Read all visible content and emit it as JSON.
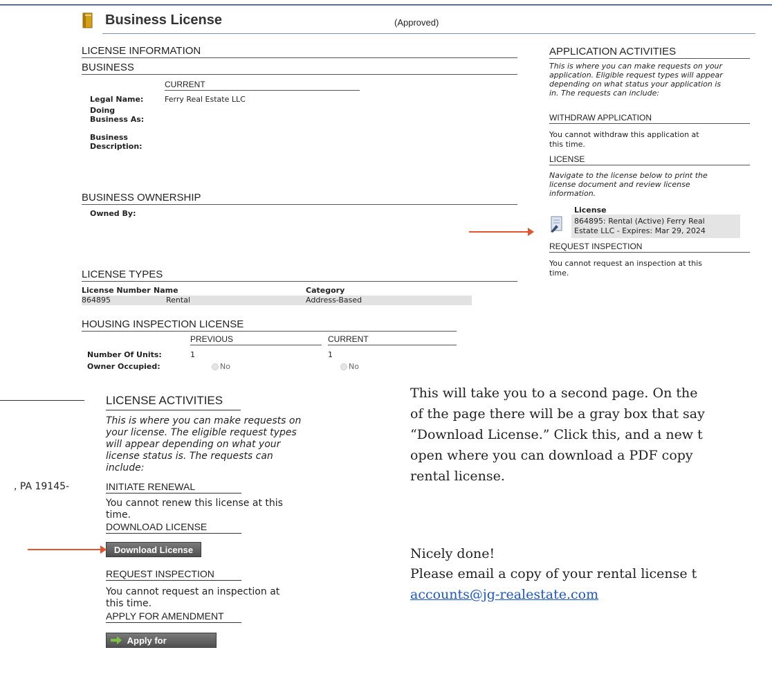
{
  "header": {
    "title": "Business License",
    "status": "(Approved)"
  },
  "license_info": {
    "section_title": "LICENSE INFORMATION",
    "business": {
      "title": "BUSINESS",
      "col_current": "CURRENT",
      "legal_name_label": "Legal Name:",
      "legal_name_value": "Ferry Real Estate LLC",
      "dba_label_1": "Doing",
      "dba_label_2": "Business As:",
      "desc_label_1": "Business",
      "desc_label_2": "Description:"
    },
    "ownership": {
      "title": "BUSINESS OWNERSHIP",
      "owned_by_label": "Owned By:"
    },
    "license_types": {
      "title": "LICENSE TYPES",
      "col_number": "License Number",
      "col_name": "Name",
      "col_category": "Category",
      "rows": [
        {
          "number": "864895",
          "name": "Rental",
          "category": "Address-Based"
        }
      ]
    },
    "housing": {
      "title": "HOUSING INSPECTION LICENSE",
      "col_previous": "PREVIOUS",
      "col_current": "CURRENT",
      "units_label": "Number Of Units:",
      "units_previous": "1",
      "units_current": "1",
      "owner_label": "Owner Occupied:",
      "owner_previous": "No",
      "owner_current": "No"
    }
  },
  "application_activities": {
    "title": "APPLICATION ACTIVITIES",
    "intro_1": "This is where you can make requests on your",
    "intro_2": "application. Eligible request types will appear",
    "intro_3": "depending on what status your application is",
    "intro_4": "in. The requests can include:",
    "withdraw_title": "WITHDRAW APPLICATION",
    "withdraw_text_1": "You cannot withdraw this application at",
    "withdraw_text_2": "this time.",
    "license_title": "LICENSE",
    "license_text_1": "Navigate to the license below to print the",
    "license_text_2": "license document and review license",
    "license_text_3": "information.",
    "license_link_label": "License",
    "license_link_text_1": "864895: Rental (Active) Ferry Real",
    "license_link_text_2": "Estate LLC - Expires: Mar 29, 2024",
    "inspection_title": "REQUEST INSPECTION",
    "inspection_text_1": "You cannot request an inspection at this",
    "inspection_text_2": "time."
  },
  "license_activities": {
    "address_fragment": ", PA 19145-",
    "title": "LICENSE ACTIVITIES",
    "intro_1": "This is where you can make requests on",
    "intro_2": "your license. The eligible request types",
    "intro_3": "will appear depending on what your",
    "intro_4": "license status is. The requests can",
    "intro_5": "include:",
    "renewal_title": "INITIATE RENEWAL",
    "renewal_text_1": "You cannot renew this license at this",
    "renewal_text_2": "time.",
    "download_title": "DOWNLOAD LICENSE",
    "download_button": "Download License",
    "inspection_title": "REQUEST INSPECTION",
    "inspection_text_1": "You cannot request an inspection at",
    "inspection_text_2": "this time.",
    "amend_title": "APPLY FOR AMENDMENT",
    "amend_button": "Apply for Amendment"
  },
  "instructions": {
    "line_1": "This will take you to a second page. On the",
    "line_2": "of the page there will be a gray box that say",
    "line_3": "“Download License.” Click this, and a new t",
    "line_4": "open where you can download a PDF copy",
    "line_5": "rental license.",
    "done": "Nicely done!",
    "email_line": "Please email a copy of your rental license t",
    "email": "accounts@jg-realestate.com"
  },
  "colors": {
    "arrow": "#e5532e",
    "link": "#1a56c8",
    "row_bg": "#e2e2e2",
    "button_bg": "#5e5e5e"
  }
}
